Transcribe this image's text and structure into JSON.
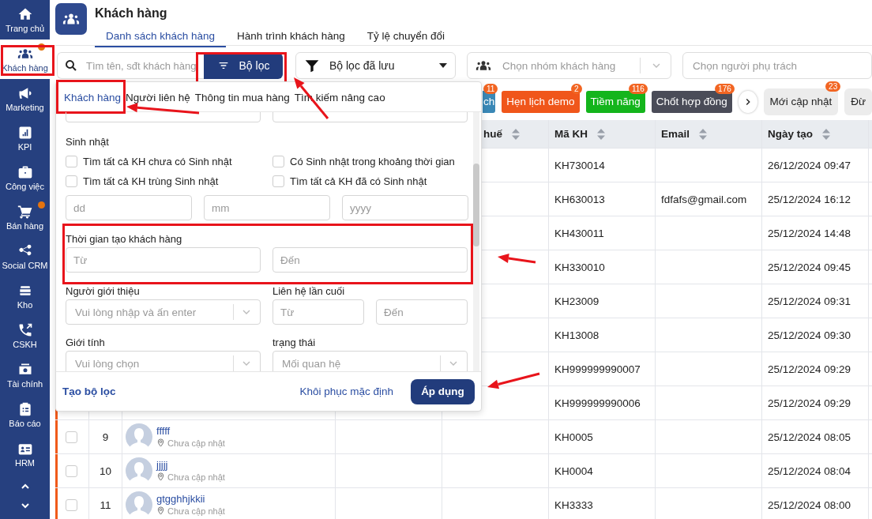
{
  "sidebar": {
    "items": [
      {
        "label": "Trang chủ",
        "selected": false,
        "dot": false,
        "highlighted": false
      },
      {
        "label": "Khách hàng",
        "selected": true,
        "dot": true,
        "highlighted": true
      },
      {
        "label": "Marketing",
        "selected": false,
        "dot": false,
        "highlighted": false
      },
      {
        "label": "KPI",
        "selected": false,
        "dot": false,
        "highlighted": false
      },
      {
        "label": "Công việc",
        "selected": false,
        "dot": false,
        "highlighted": false
      },
      {
        "label": "Bán hàng",
        "selected": false,
        "dot": true,
        "highlighted": false
      },
      {
        "label": "Social CRM",
        "selected": false,
        "dot": false,
        "highlighted": false
      },
      {
        "label": "Kho",
        "selected": false,
        "dot": false,
        "highlighted": false
      },
      {
        "label": "CSKH",
        "selected": false,
        "dot": false,
        "highlighted": false
      },
      {
        "label": "Tài chính",
        "selected": false,
        "dot": false,
        "highlighted": false
      },
      {
        "label": "Báo cáo",
        "selected": false,
        "dot": false,
        "highlighted": false
      },
      {
        "label": "HRM",
        "selected": false,
        "dot": false,
        "highlighted": false
      }
    ]
  },
  "header": {
    "title": "Khách hàng",
    "tabs": [
      {
        "label": "Danh sách khách hàng",
        "selected": true
      },
      {
        "label": "Hành trình khách hàng",
        "selected": false
      },
      {
        "label": "Tỷ lệ chuyển đổi",
        "selected": false
      }
    ]
  },
  "toolbar": {
    "search": {
      "placeholder": "Tìm tên, sđt khách hàng"
    },
    "filter_button": {
      "label": "Bộ lọc",
      "highlighted": true,
      "arrow": true
    },
    "saved_filter": {
      "value": "Bộ lọc đã lưu"
    },
    "group_select": {
      "placeholder": "Chọn nhóm khách hàng"
    },
    "owner_select": {
      "placeholder": "Chọn người phụ trách"
    }
  },
  "status_chips": [
    {
      "label": "ch",
      "count": "11",
      "color": "#3a88b6"
    },
    {
      "label": "Hẹn lịch demo",
      "count": "2",
      "color": "#f0561b"
    },
    {
      "label": "Tiềm năng",
      "count": "116",
      "color": "#14b51c"
    },
    {
      "label": "Chốt hợp đồng",
      "count": "176",
      "color": "#4a4c58"
    }
  ],
  "quick_filters": [
    {
      "label": "Mới cập nhật",
      "count": "23"
    },
    {
      "label": "Đừ"
    }
  ],
  "table": {
    "columns": [
      {
        "label": "huế"
      },
      {
        "label": "Mã KH"
      },
      {
        "label": "Email"
      },
      {
        "label": "Ngày tạo"
      }
    ],
    "rows": [
      {
        "code": "KH730014",
        "created": "26/12/2024 09:47"
      },
      {
        "code": "KH630013",
        "email": "fdfafs@gmail.com",
        "created": "25/12/2024 16:12"
      },
      {
        "code": "KH430011",
        "created": "25/12/2024 14:48"
      },
      {
        "code": "KH330010",
        "created": "25/12/2024 09:45"
      },
      {
        "code": "KH23009",
        "created": "25/12/2024 09:31"
      },
      {
        "code": "KH13008",
        "created": "25/12/2024 09:30"
      },
      {
        "code": "KH999999990007",
        "created": "25/12/2024 09:29"
      },
      {
        "code": "KH999999990006",
        "created": "25/12/2024 09:29"
      },
      {
        "checked": false,
        "number": "9",
        "name": "fffff",
        "address": "Chưa cập nhật",
        "code": "KH0005",
        "created": "25/12/2024 08:05"
      },
      {
        "checked": false,
        "number": "10",
        "name": "jjjjj",
        "address": "Chưa cập nhật",
        "code": "KH0004",
        "created": "25/12/2024 08:04"
      },
      {
        "checked": false,
        "number": "11",
        "name": "gtgghhjkkii",
        "address": "Chưa cập nhật",
        "code": "KH3333",
        "created": "25/12/2024 08:00"
      }
    ]
  },
  "filter_panel": {
    "tabs": [
      {
        "label": "Khách hàng",
        "selected": true,
        "highlighted": true
      },
      {
        "label": "Người liên hệ",
        "selected": false,
        "highlighted": false
      },
      {
        "label": "Thông tin mua hàng",
        "selected": false,
        "highlighted": false
      },
      {
        "label": "Tìm kiếm nâng cao",
        "selected": false,
        "highlighted": false
      }
    ],
    "tab_arrow": true,
    "birthday": {
      "label": "Sinh nhật",
      "options": [
        {
          "label": "Tìm tất cả KH chưa có Sinh nhật",
          "checked": false
        },
        {
          "label": "Có Sinh nhật trong khoảng thời gian",
          "checked": false
        },
        {
          "label": "Tìm tất cả KH trùng Sinh nhật",
          "checked": false
        },
        {
          "label": "Tìm tất cả KH đã có Sinh nhật",
          "checked": false
        }
      ],
      "day": {
        "placeholder": "dd"
      },
      "month": {
        "placeholder": "mm"
      },
      "year": {
        "placeholder": "yyyy"
      }
    },
    "created_time": {
      "label": "Thời gian tạo khách hàng",
      "highlighted": true,
      "arrow": true,
      "from": {
        "placeholder": "Từ"
      },
      "to": {
        "placeholder": "Đến"
      }
    },
    "referrer": {
      "label": "Người giới thiệu",
      "placeholder": "Vui lòng nhập và ấn enter"
    },
    "last_contact": {
      "label": "Liên hệ lần cuối",
      "from": {
        "placeholder": "Từ"
      },
      "to": {
        "placeholder": "Đến"
      }
    },
    "gender": {
      "label": "Giới tính",
      "placeholder": "Vui lòng chọn"
    },
    "status": {
      "label": "trạng thái",
      "placeholder": "Mối quan hệ"
    },
    "footer": {
      "create_link": "Tạo bộ lọc",
      "reset_link": "Khôi phục mặc định",
      "apply_button": "Áp dụng",
      "apply_arrow": true
    }
  }
}
